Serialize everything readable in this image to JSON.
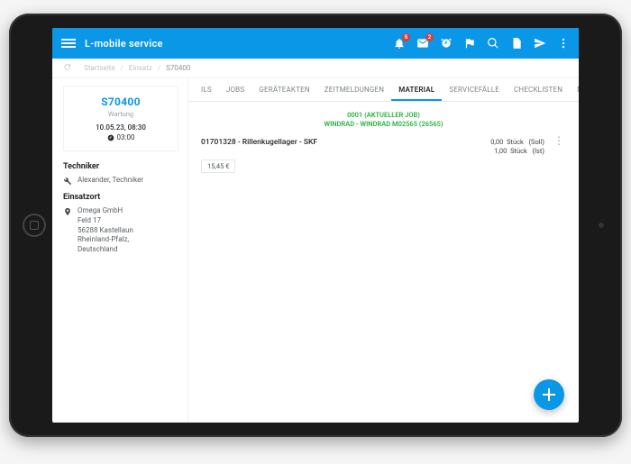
{
  "app": {
    "title": "L-mobile service"
  },
  "appbar_badges": {
    "notif": "5",
    "mail": "2"
  },
  "breadcrumb": {
    "home": "Startseite",
    "mid": "Einsatz",
    "current": "S70400"
  },
  "sidebar": {
    "service_id": "S70400",
    "service_type": "Wartung",
    "datetime": "10.05.23, 08:30",
    "duration": "03:00",
    "tech_heading": "Techniker",
    "tech_name": "Alexander, Techniker",
    "loc_heading": "Einsatzort",
    "loc_name": "Omega GmbH",
    "loc_street": "Feld 17",
    "loc_city": "56288 Kastellaun",
    "loc_region": "Rheinland-Pfalz,",
    "loc_country": "Deutschland"
  },
  "tabs": {
    "t0": "ILS",
    "t1": "JOBS",
    "t2": "GERÄTEAKTEN",
    "t3": "ZEITMELDUNGEN",
    "t4": "MATERIAL",
    "t5": "SERVICEFÄLLE",
    "t6": "CHECKLISTEN",
    "t7": "NOTIZEN"
  },
  "job": {
    "line1": "0001 (AKTUELLER JOB)",
    "line2": "WINDRAD - WINDRAD M02565 (26565)"
  },
  "material": {
    "row0": {
      "name": "01701328 - Rillenkugellager - SKF",
      "soll_qty": "0,00",
      "ist_qty": "1,00",
      "unit": "Stück",
      "soll_lbl": "(Soll)",
      "ist_lbl": "(Ist)",
      "price": "15,45 €"
    }
  }
}
